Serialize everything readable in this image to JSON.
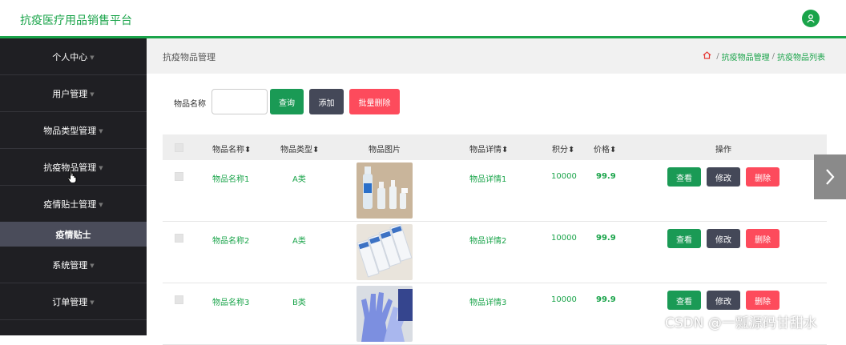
{
  "app": {
    "title": "抗疫医疗用品销售平台",
    "accent": "#1aa44a"
  },
  "sidebar": {
    "items": [
      {
        "label": "个人中心"
      },
      {
        "label": "用户管理"
      },
      {
        "label": "物品类型管理"
      },
      {
        "label": "抗疫物品管理"
      },
      {
        "label": "疫情贴士管理"
      },
      {
        "label": "系统管理"
      },
      {
        "label": "订单管理"
      }
    ],
    "sub_item": "疫情贴士",
    "caret": "▼"
  },
  "header": {
    "page_title": "抗疫物品管理",
    "breadcrumb": [
      "抗疫物品管理",
      "抗疫物品列表"
    ],
    "breadcrumb_sep": "/"
  },
  "search": {
    "label": "物品名称",
    "value": "",
    "query_btn": "查询",
    "add_btn": "添加",
    "batch_delete_btn": "批量删除"
  },
  "table": {
    "headers": [
      "物品名称",
      "物品类型",
      "物品图片",
      "物品详情",
      "积分",
      "价格",
      "操作"
    ],
    "sort_icon": "⬍",
    "rows": [
      {
        "name": "物品名称1",
        "type": "A类",
        "detail": "物品详情1",
        "points": "10000",
        "price": "99.9",
        "image": "bottles"
      },
      {
        "name": "物品名称2",
        "type": "A类",
        "detail": "物品详情2",
        "points": "10000",
        "price": "99.9",
        "image": "masks"
      },
      {
        "name": "物品名称3",
        "type": "B类",
        "detail": "物品详情3",
        "points": "10000",
        "price": "99.9",
        "image": "gloves"
      }
    ],
    "actions": {
      "view": "查看",
      "edit": "修改",
      "delete": "删除"
    }
  },
  "watermark": "CSDN @一瓢源码甘甜水",
  "colors": {
    "green": "#1a9a55",
    "dark": "#444858",
    "red": "#fd4b5c",
    "sidebar_bg": "#1f1f23",
    "sidebar_active": "#4a4c5a"
  }
}
